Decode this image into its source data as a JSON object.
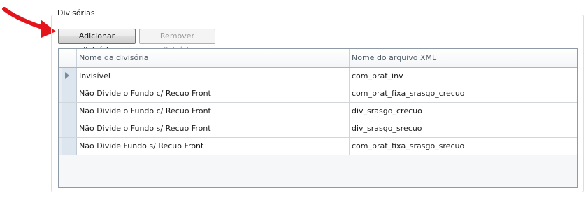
{
  "group": {
    "title": "Divisórias"
  },
  "buttons": {
    "add_label": "Adicionar divisória",
    "remove_label": "Remover divisória"
  },
  "grid": {
    "columns": [
      "Nome da divisória",
      "Nome do arquivo XML"
    ],
    "rows": [
      {
        "name": "Invisível",
        "file": "com_prat_inv",
        "current": true
      },
      {
        "name": "Não Divide o Fundo c/ Recuo Front",
        "file": "com_prat_fixa_srasgo_crecuo"
      },
      {
        "name": "Não Divide o Fundo c/ Recuo Front",
        "file": "div_srasgo_crecuo"
      },
      {
        "name": "Não Divide o Fundo s/ Recuo Front",
        "file": "div_srasgo_srecuo"
      },
      {
        "name": "Não Divide Fundo s/ Recuo Front",
        "file": "com_prat_fixa_srasgo_srecuo"
      }
    ]
  },
  "annotation": {
    "icon": "red-arrow-icon",
    "color": "#e3141b"
  }
}
